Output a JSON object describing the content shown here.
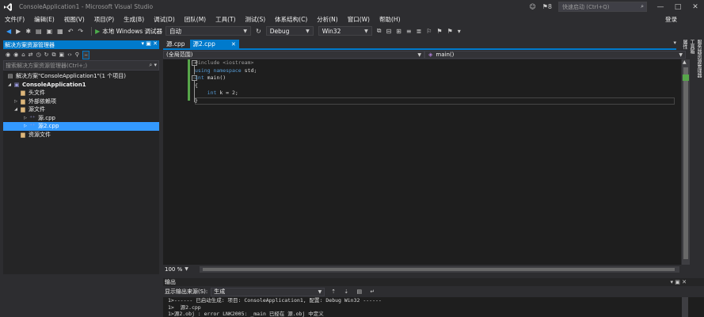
{
  "window": {
    "title": "ConsoleApplication1 - Microsoft Visual Studio",
    "notifications": "8",
    "quicklaunch_placeholder": "快速启动 (Ctrl+Q)",
    "login": "登录"
  },
  "menu": [
    "文件(F)",
    "编辑(E)",
    "视图(V)",
    "项目(P)",
    "生成(B)",
    "调试(D)",
    "团队(M)",
    "工具(T)",
    "测试(S)",
    "体系结构(C)",
    "分析(N)",
    "窗口(W)",
    "帮助(H)"
  ],
  "toolbar": {
    "run_label": "本地 Windows 调试器",
    "run_mode": "自动",
    "config": "Debug",
    "platform": "Win32"
  },
  "solution_explorer": {
    "title": "解决方案资源管理器",
    "search_placeholder": "搜索解决方案资源管理器(Ctrl+;)",
    "tree": [
      {
        "label": "解决方案\"ConsoleApplication1\"(1 个项目)"
      },
      {
        "label": "ConsoleApplication1"
      },
      {
        "label": "头文件"
      },
      {
        "label": "外部依赖项"
      },
      {
        "label": "源文件"
      },
      {
        "label": "源.cpp"
      },
      {
        "label": "源2.cpp"
      },
      {
        "label": "资源文件"
      }
    ]
  },
  "editor": {
    "tabs": [
      "源.cpp",
      "源2.cpp"
    ],
    "scope": "(全局范围)",
    "function": "main()",
    "code": [
      {
        "pre": "#include <iostream>"
      },
      {
        "kw": "using namespace",
        "text": " std;"
      },
      {
        "kw": "int",
        "text": " main()"
      },
      {
        "text": "{"
      },
      {
        "indent": "    ",
        "kw": "int",
        "text": " k = 2;"
      },
      {
        "text": "}"
      }
    ],
    "zoom": "100 %"
  },
  "side_strip": [
    "服务器资源管理器",
    "工具箱",
    "属性"
  ],
  "output": {
    "title": "输出",
    "source_label": "显示输出来源(S):",
    "source_value": "生成",
    "lines": [
      "1>------ 已启动生成: 项目: ConsoleApplication1, 配置: Debug Win32 ------",
      "1>  源2.cpp",
      "1>源2.obj : error LNK2005: _main 已经在 源.obj 中定义"
    ]
  }
}
